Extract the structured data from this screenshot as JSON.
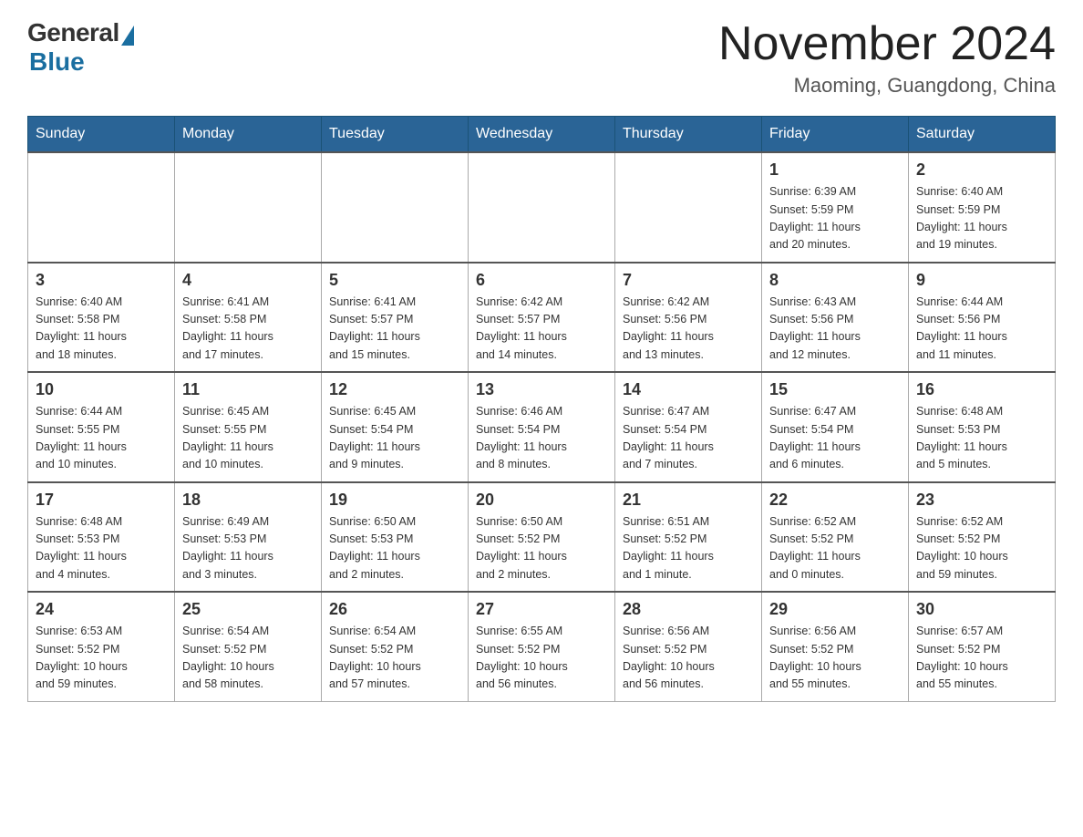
{
  "header": {
    "logo_general": "General",
    "logo_blue": "Blue",
    "month_title": "November 2024",
    "location": "Maoming, Guangdong, China"
  },
  "days_of_week": [
    "Sunday",
    "Monday",
    "Tuesday",
    "Wednesday",
    "Thursday",
    "Friday",
    "Saturday"
  ],
  "weeks": [
    [
      {
        "day": "",
        "info": ""
      },
      {
        "day": "",
        "info": ""
      },
      {
        "day": "",
        "info": ""
      },
      {
        "day": "",
        "info": ""
      },
      {
        "day": "",
        "info": ""
      },
      {
        "day": "1",
        "info": "Sunrise: 6:39 AM\nSunset: 5:59 PM\nDaylight: 11 hours\nand 20 minutes."
      },
      {
        "day": "2",
        "info": "Sunrise: 6:40 AM\nSunset: 5:59 PM\nDaylight: 11 hours\nand 19 minutes."
      }
    ],
    [
      {
        "day": "3",
        "info": "Sunrise: 6:40 AM\nSunset: 5:58 PM\nDaylight: 11 hours\nand 18 minutes."
      },
      {
        "day": "4",
        "info": "Sunrise: 6:41 AM\nSunset: 5:58 PM\nDaylight: 11 hours\nand 17 minutes."
      },
      {
        "day": "5",
        "info": "Sunrise: 6:41 AM\nSunset: 5:57 PM\nDaylight: 11 hours\nand 15 minutes."
      },
      {
        "day": "6",
        "info": "Sunrise: 6:42 AM\nSunset: 5:57 PM\nDaylight: 11 hours\nand 14 minutes."
      },
      {
        "day": "7",
        "info": "Sunrise: 6:42 AM\nSunset: 5:56 PM\nDaylight: 11 hours\nand 13 minutes."
      },
      {
        "day": "8",
        "info": "Sunrise: 6:43 AM\nSunset: 5:56 PM\nDaylight: 11 hours\nand 12 minutes."
      },
      {
        "day": "9",
        "info": "Sunrise: 6:44 AM\nSunset: 5:56 PM\nDaylight: 11 hours\nand 11 minutes."
      }
    ],
    [
      {
        "day": "10",
        "info": "Sunrise: 6:44 AM\nSunset: 5:55 PM\nDaylight: 11 hours\nand 10 minutes."
      },
      {
        "day": "11",
        "info": "Sunrise: 6:45 AM\nSunset: 5:55 PM\nDaylight: 11 hours\nand 10 minutes."
      },
      {
        "day": "12",
        "info": "Sunrise: 6:45 AM\nSunset: 5:54 PM\nDaylight: 11 hours\nand 9 minutes."
      },
      {
        "day": "13",
        "info": "Sunrise: 6:46 AM\nSunset: 5:54 PM\nDaylight: 11 hours\nand 8 minutes."
      },
      {
        "day": "14",
        "info": "Sunrise: 6:47 AM\nSunset: 5:54 PM\nDaylight: 11 hours\nand 7 minutes."
      },
      {
        "day": "15",
        "info": "Sunrise: 6:47 AM\nSunset: 5:54 PM\nDaylight: 11 hours\nand 6 minutes."
      },
      {
        "day": "16",
        "info": "Sunrise: 6:48 AM\nSunset: 5:53 PM\nDaylight: 11 hours\nand 5 minutes."
      }
    ],
    [
      {
        "day": "17",
        "info": "Sunrise: 6:48 AM\nSunset: 5:53 PM\nDaylight: 11 hours\nand 4 minutes."
      },
      {
        "day": "18",
        "info": "Sunrise: 6:49 AM\nSunset: 5:53 PM\nDaylight: 11 hours\nand 3 minutes."
      },
      {
        "day": "19",
        "info": "Sunrise: 6:50 AM\nSunset: 5:53 PM\nDaylight: 11 hours\nand 2 minutes."
      },
      {
        "day": "20",
        "info": "Sunrise: 6:50 AM\nSunset: 5:52 PM\nDaylight: 11 hours\nand 2 minutes."
      },
      {
        "day": "21",
        "info": "Sunrise: 6:51 AM\nSunset: 5:52 PM\nDaylight: 11 hours\nand 1 minute."
      },
      {
        "day": "22",
        "info": "Sunrise: 6:52 AM\nSunset: 5:52 PM\nDaylight: 11 hours\nand 0 minutes."
      },
      {
        "day": "23",
        "info": "Sunrise: 6:52 AM\nSunset: 5:52 PM\nDaylight: 10 hours\nand 59 minutes."
      }
    ],
    [
      {
        "day": "24",
        "info": "Sunrise: 6:53 AM\nSunset: 5:52 PM\nDaylight: 10 hours\nand 59 minutes."
      },
      {
        "day": "25",
        "info": "Sunrise: 6:54 AM\nSunset: 5:52 PM\nDaylight: 10 hours\nand 58 minutes."
      },
      {
        "day": "26",
        "info": "Sunrise: 6:54 AM\nSunset: 5:52 PM\nDaylight: 10 hours\nand 57 minutes."
      },
      {
        "day": "27",
        "info": "Sunrise: 6:55 AM\nSunset: 5:52 PM\nDaylight: 10 hours\nand 56 minutes."
      },
      {
        "day": "28",
        "info": "Sunrise: 6:56 AM\nSunset: 5:52 PM\nDaylight: 10 hours\nand 56 minutes."
      },
      {
        "day": "29",
        "info": "Sunrise: 6:56 AM\nSunset: 5:52 PM\nDaylight: 10 hours\nand 55 minutes."
      },
      {
        "day": "30",
        "info": "Sunrise: 6:57 AM\nSunset: 5:52 PM\nDaylight: 10 hours\nand 55 minutes."
      }
    ]
  ]
}
